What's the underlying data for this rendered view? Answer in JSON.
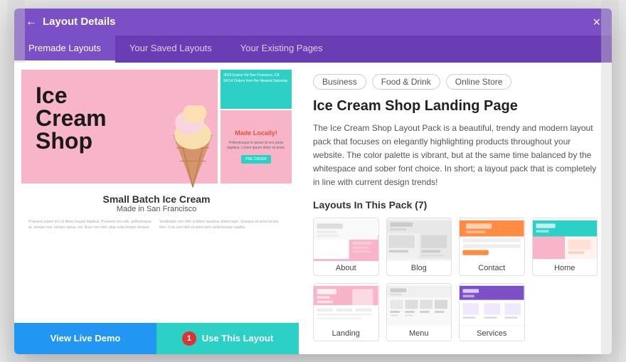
{
  "modal": {
    "title": "Layout Details",
    "close_label": "×",
    "back_label": "←"
  },
  "tabs": [
    {
      "id": "premade",
      "label": "Premade Layouts",
      "active": true
    },
    {
      "id": "saved",
      "label": "Your Saved Layouts",
      "active": false
    },
    {
      "id": "existing",
      "label": "Your Existing Pages",
      "active": false
    }
  ],
  "preview": {
    "title": "Small Batch Ice Cream",
    "subtitle": "Made in San Francisco",
    "made_locally": "Made Locally!",
    "ice_cream_title": "Ice Cream Shop",
    "teal_address": "3019 Eunice Rd\nSan Francisco, CA 94114\nOrders from the Nearest Saturday",
    "text_col1": "Praesent autem orci ut libero feugiat dapibus. Praesent nisi odio, pellentesque at, semper non, tempor varius, est. Nunc non nibh vitae nulla tempor tempus.",
    "text_col2": "Vestibulum non nibh ut libero faucibus ullamcorper. Quisque sit amet lacinia felis. Cras sed nibh sit amet nunc pellentesque sagittis."
  },
  "buttons": {
    "view_demo": "View Live Demo",
    "use_layout": "Use This Layout",
    "badge": "1"
  },
  "right_panel": {
    "tags": [
      "Business",
      "Food & Drink",
      "Online Store"
    ],
    "page_title": "Ice Cream Shop Landing Page",
    "description": "The Ice Cream Shop Layout Pack is a beautiful, trendy and modern layout pack that focuses on elegantly highlighting products throughout your website. The color palette is vibrant, but at the same time balanced by the whitespace and sober font choice. In short; a layout pack that is completely in line with current design trends!",
    "layouts_heading": "Layouts In This Pack (7)",
    "layouts": [
      {
        "id": "about",
        "label": "About",
        "theme": "about"
      },
      {
        "id": "blog",
        "label": "Blog",
        "theme": "blog"
      },
      {
        "id": "contact",
        "label": "Contact",
        "theme": "contact"
      },
      {
        "id": "home",
        "label": "Home",
        "theme": "home"
      },
      {
        "id": "landing",
        "label": "Landing",
        "theme": "landing"
      },
      {
        "id": "menu",
        "label": "Menu",
        "theme": "menu"
      },
      {
        "id": "services",
        "label": "Services",
        "theme": "services"
      }
    ]
  },
  "colors": {
    "header_bg": "#7b4fc5",
    "tab_bg": "#6b3db5",
    "tab_active_bg": "#7b4fc5",
    "teal": "#2dd0c4",
    "pink": "#f8b4c8",
    "blue_btn": "#2196F3",
    "orange": "#ff8c42",
    "red_badge": "#e03030"
  }
}
